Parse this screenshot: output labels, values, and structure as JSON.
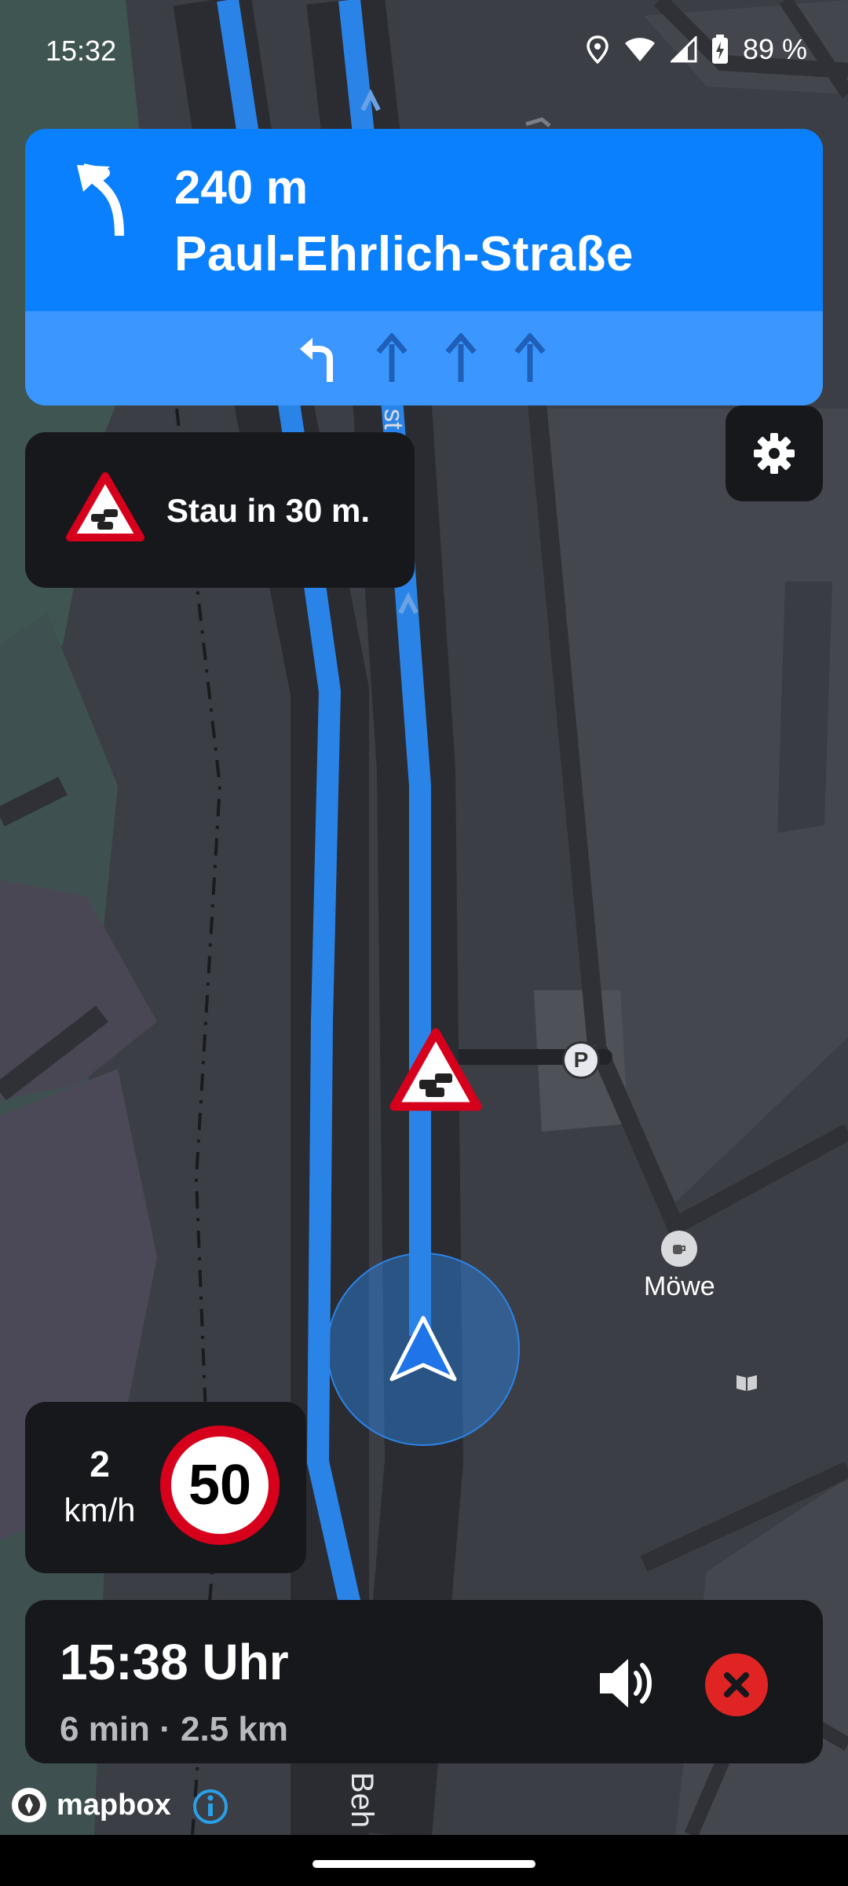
{
  "status_bar": {
    "time": "15:32",
    "battery": "89 %",
    "icons": [
      "location-icon",
      "wifi-icon",
      "signal-icon",
      "battery-icon"
    ]
  },
  "maneuver": {
    "distance": "240 m",
    "street": "Paul-Ehrlich-Straße",
    "turn_icon": "turn-left-icon",
    "lanes": [
      "turn-left",
      "straight",
      "straight",
      "straight"
    ]
  },
  "traffic_warning": {
    "icon": "traffic-jam-icon",
    "text": "Stau in 30 m."
  },
  "settings": {
    "icon": "gear-icon"
  },
  "speed": {
    "value": "2",
    "unit": "km/h",
    "limit": "50"
  },
  "trip": {
    "eta": "15:38 Uhr",
    "summary": "6 min · 2.5 km"
  },
  "map": {
    "poi_label": "Möwe",
    "road_label_top": "st",
    "road_label_bottom": "Beh"
  },
  "attribution": {
    "logo": "mapbox"
  },
  "colors": {
    "route": "#2a84e8",
    "banner": "#0a80ff",
    "lanes": "#3b97ff",
    "panel": "#16181c",
    "close": "#e02424",
    "speed_limit_ring": "#d6001c"
  }
}
